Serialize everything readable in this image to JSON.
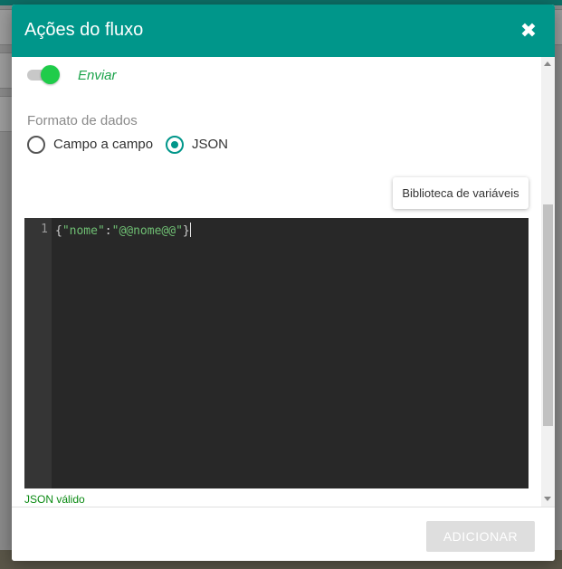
{
  "modal": {
    "title": "Ações do fluxo",
    "close_glyph": "✖"
  },
  "send_toggle": {
    "label": "Enviar",
    "on": true,
    "color": "#1fcc4a"
  },
  "data_format": {
    "label": "Formato de dados",
    "options": [
      {
        "label": "Campo a campo",
        "selected": false
      },
      {
        "label": "JSON",
        "selected": true
      }
    ]
  },
  "variable_library_button": "Biblioteca de variáveis",
  "editor": {
    "line_number": "1",
    "code": {
      "open": "{",
      "key": "\"nome\"",
      "colon": ":",
      "value": "\"@@nome@@\"",
      "close": "}"
    }
  },
  "json_status": "JSON válido",
  "footer": {
    "add_label": "ADICIONAR",
    "add_enabled": false
  },
  "colors": {
    "header": "#00968a",
    "valid_text": "#0a8a12"
  },
  "icons": {
    "close": "close-icon",
    "scroll_up": "arrow-up-icon",
    "scroll_down": "arrow-down-icon"
  }
}
